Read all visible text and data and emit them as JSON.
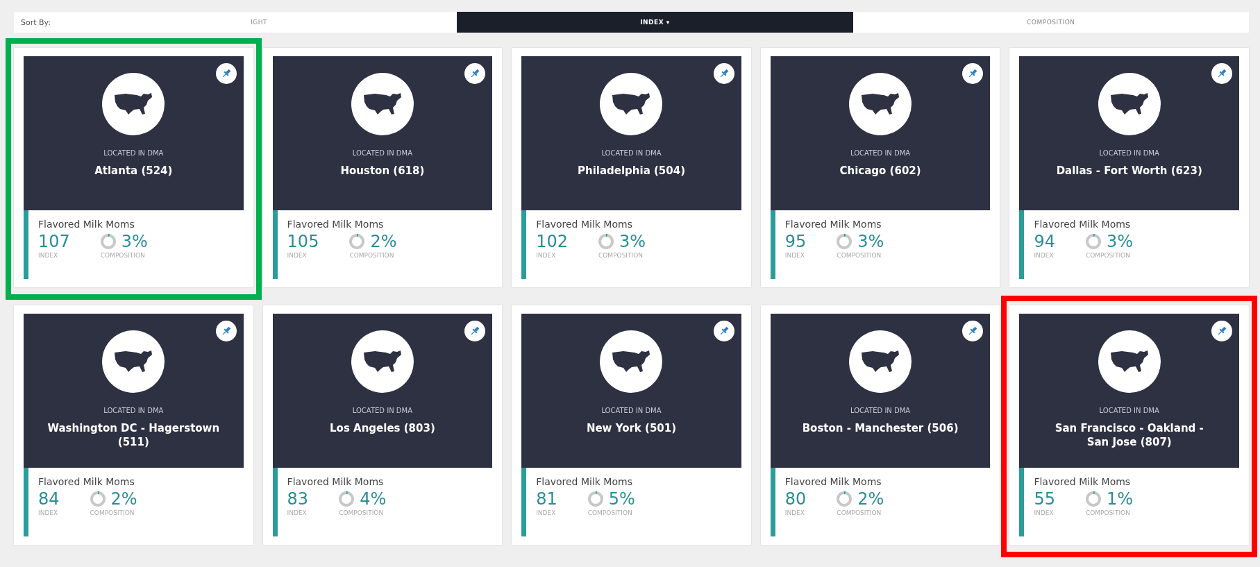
{
  "sort_by": {
    "label": "Sort By:"
  },
  "tabs": [
    {
      "label": "IGHT",
      "selected": false
    },
    {
      "label": "INDEX ▾",
      "selected": true
    },
    {
      "label": "COMPOSITION",
      "selected": false
    }
  ],
  "cards": [
    {
      "caption": "LOCATED IN DMA",
      "name": "Atlanta (524)",
      "segment": "Flavored Milk Moms",
      "index": "107",
      "index_label": "INDEX",
      "composition": "3%",
      "composition_label": "COMPOSITION",
      "color": "#00b050"
    },
    {
      "caption": "LOCATED IN DMA",
      "name": "Houston (618)",
      "segment": "Flavored Milk Moms",
      "index": "105",
      "index_label": "INDEX",
      "composition": "2%",
      "composition_label": "COMPOSITION"
    },
    {
      "caption": "LOCATED IN DMA",
      "name": "Philadelphia (504)",
      "segment": "Flavored Milk Moms",
      "index": "102",
      "index_label": "INDEX",
      "composition": "3%",
      "composition_label": "COMPOSITION"
    },
    {
      "caption": "LOCATED IN DMA",
      "name": "Chicago (602)",
      "segment": "Flavored Milk Moms",
      "index": "95",
      "index_label": "INDEX",
      "composition": "3%",
      "composition_label": "COMPOSITION"
    },
    {
      "caption": "LOCATED IN DMA",
      "name": "Dallas - Fort Worth (623)",
      "segment": "Flavored Milk Moms",
      "index": "94",
      "index_label": "INDEX",
      "composition": "3%",
      "composition_label": "COMPOSITION"
    },
    {
      "caption": "LOCATED IN DMA",
      "name": "Washington DC - Hagerstown (511)",
      "segment": "Flavored Milk Moms",
      "index": "84",
      "index_label": "INDEX",
      "composition": "2%",
      "composition_label": "COMPOSITION"
    },
    {
      "caption": "LOCATED IN DMA",
      "name": "Los Angeles (803)",
      "segment": "Flavored Milk Moms",
      "index": "83",
      "index_label": "INDEX",
      "composition": "4%",
      "composition_label": "COMPOSITION"
    },
    {
      "caption": "LOCATED IN DMA",
      "name": "New York (501)",
      "segment": "Flavored Milk Moms",
      "index": "81",
      "index_label": "INDEX",
      "composition": "5%",
      "composition_label": "COMPOSITION"
    },
    {
      "caption": "LOCATED IN DMA",
      "name": "Boston - Manchester (506)",
      "segment": "Flavored Milk Moms",
      "index": "80",
      "index_label": "INDEX",
      "composition": "2%",
      "composition_label": "COMPOSITION"
    },
    {
      "caption": "LOCATED IN DMA",
      "name": "San Francisco - Oakland - San Jose (807)",
      "segment": "Flavored Milk Moms",
      "index": "55",
      "index_label": "INDEX",
      "composition": "1%",
      "composition_label": "COMPOSITION",
      "color": "#ff0000"
    }
  ]
}
